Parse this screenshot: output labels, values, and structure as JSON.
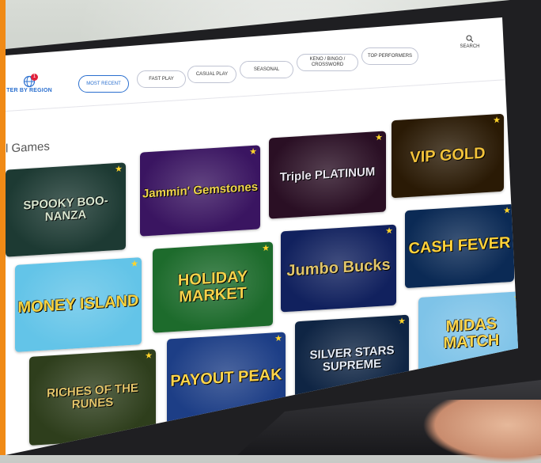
{
  "header": {
    "region_label": "TER BY REGION",
    "region_badge": "1",
    "tabs": [
      "MOST RECENT",
      "FAST PLAY",
      "CASUAL PLAY",
      "SEASONAL",
      "KENO / BINGO / CROSSWORD",
      "TOP PERFORMERS"
    ],
    "search_label": "SEARCH"
  },
  "main": {
    "title": "l Games",
    "games": [
      {
        "name": "SPOOKY BOO-NANZA",
        "bg": "#1d3a33",
        "fg": "#d9e6cf"
      },
      {
        "name": "Jammin' Gemstones",
        "bg": "#3a1561",
        "fg": "#f0d64a"
      },
      {
        "name": "Triple PLATINUM",
        "bg": "#2a0f24",
        "fg": "#e9e4ee"
      },
      {
        "name": "VIP GOLD",
        "bg": "#2a1a05",
        "fg": "#f2c23a"
      },
      {
        "name": "MONEY ISLAND",
        "bg": "#63c4e8",
        "fg": "#f7d23e"
      },
      {
        "name": "HOLIDAY MARKET",
        "bg": "#1d6b2c",
        "fg": "#f6d24a"
      },
      {
        "name": "Jumbo Bucks",
        "bg": "#11215e",
        "fg": "#e2c66a"
      },
      {
        "name": "CASH FEVER",
        "bg": "#0b2a55",
        "fg": "#ffd23a"
      },
      {
        "name": "RICHES OF THE RUNES",
        "bg": "#2e3e1c",
        "fg": "#e3c56a"
      },
      {
        "name": "PAYOUT PEAK",
        "bg": "#1d3e86",
        "fg": "#ffd54a"
      },
      {
        "name": "SILVER STARS SUPREME",
        "bg": "#0f2544",
        "fg": "#e5ecf7"
      },
      {
        "name": "MIDAS MATCH",
        "bg": "#7ec3e8",
        "fg": "#ffd64a"
      }
    ]
  },
  "colors": {
    "accent": "#2a6fcf",
    "star": "#ffd42a",
    "orange": "#f08a16"
  }
}
